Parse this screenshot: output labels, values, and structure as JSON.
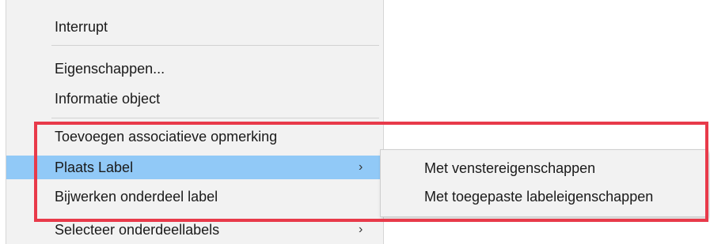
{
  "context_menu": {
    "items": [
      {
        "label": "Interrupt"
      },
      {
        "label": "Eigenschappen..."
      },
      {
        "label": "Informatie object"
      },
      {
        "label": "Toevoegen associatieve opmerking"
      },
      {
        "label": "Plaats Label",
        "has_submenu": true,
        "highlighted": true
      },
      {
        "label": "Bijwerken onderdeel label"
      },
      {
        "label": "Selecteer onderdeellabels",
        "has_submenu": true
      }
    ],
    "submenu_arrow_glyph": "›",
    "highlight_color": "#91c9f7"
  },
  "submenu": {
    "items": [
      {
        "label": "Met venstereigenschappen"
      },
      {
        "label": "Met toegepaste labeleigenschappen"
      }
    ]
  },
  "annotation": {
    "color": "#e83a4a"
  }
}
